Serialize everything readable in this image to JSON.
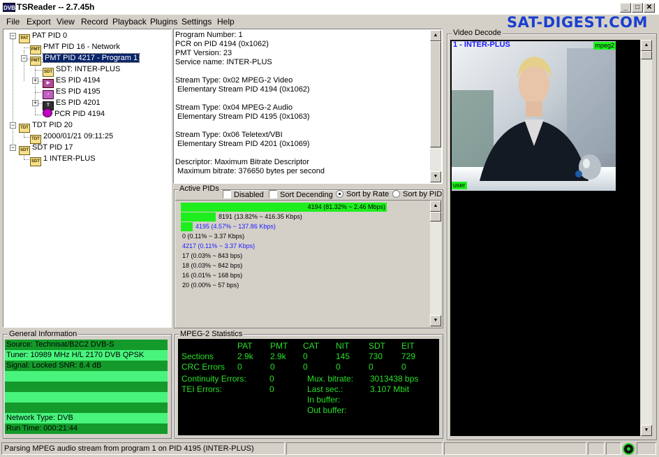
{
  "window": {
    "title": "TSReader -- 2.7.45h",
    "logo_text": "DVB",
    "watermark": "SAT-DIGEST.COM",
    "controls": {
      "minimize": "_",
      "maximize": "□",
      "close": "✕"
    }
  },
  "menu": [
    "File",
    "Export",
    "View",
    "Record",
    "Playback",
    "Plugins",
    "Settings",
    "Help"
  ],
  "tree": {
    "items": [
      {
        "label": "PAT PID 0",
        "icon": "pat-icon"
      },
      {
        "label": "PMT PID 16 - Network",
        "icon": "pmt-icon"
      },
      {
        "label": "PMT PID 4217 - Program 1",
        "icon": "pmt-icon",
        "selected": true
      },
      {
        "label": "SDT: INTER-PLUS",
        "icon": "sdt-icon"
      },
      {
        "label": "ES PID 4194",
        "icon": "video-stream-icon"
      },
      {
        "label": "ES PID 4195",
        "icon": "audio-stream-icon"
      },
      {
        "label": "ES PID 4201",
        "icon": "teletext-stream-icon"
      },
      {
        "label": "PCR PID 4194",
        "icon": "pcr-icon"
      },
      {
        "label": "TDT PID 20",
        "icon": "tdt-icon"
      },
      {
        "label": "2000/01/21 09:11:25",
        "icon": "tdt-icon"
      },
      {
        "label": "SDT PID 17",
        "icon": "sdt-icon"
      },
      {
        "label": "1 INTER-PLUS",
        "icon": "sdt-icon"
      }
    ]
  },
  "program_info": {
    "lines": [
      "Program Number: 1",
      "PCR on PID 4194 (0x1062)",
      "PMT Version: 23",
      "Service name: INTER-PLUS",
      "",
      "Stream Type: 0x02 MPEG-2 Video",
      " Elementary Stream PID 4194 (0x1062)",
      "",
      "Stream Type: 0x04 MPEG-2 Audio",
      " Elementary Stream PID 4195 (0x1063)",
      "",
      "Stream Type: 0x06 Teletext/VBI",
      " Elementary Stream PID 4201 (0x1069)",
      "",
      "Descriptor: Maximum Bitrate Descriptor",
      " Maximum bitrate: 376650 bytes per second"
    ]
  },
  "active_pids": {
    "label": "Active PIDs",
    "disabled_label": "Disabled",
    "sort_desc_label": "Sort Decending",
    "sort_rate_label": "Sort by Rate",
    "sort_pid_label": "Sort by PID",
    "rows": [
      {
        "text": "4194 (81.32% ~ 2.46 Mbps)",
        "pct": 81.32,
        "color": "#000000"
      },
      {
        "text": "8191 (13.82% ~ 416.35 Kbps)",
        "pct": 13.82,
        "color": "#000000"
      },
      {
        "text": "4195 (4.57% ~ 137.86 Kbps)",
        "pct": 4.57,
        "color": "#1a1aff"
      },
      {
        "text": "0 (0.11% ~ 3.37 Kbps)",
        "pct": 0.11,
        "color": "#000000"
      },
      {
        "text": "4217 (0.11% ~ 3.37 Kbps)",
        "pct": 0.11,
        "color": "#1a1aff"
      },
      {
        "text": "17 (0.03% ~ 843 bps)",
        "pct": 0.03,
        "color": "#000000"
      },
      {
        "text": "18 (0.03% ~ 842 bps)",
        "pct": 0.03,
        "color": "#000000"
      },
      {
        "text": "16 (0.01% ~ 168 bps)",
        "pct": 0.01,
        "color": "#000000"
      },
      {
        "text": "20 (0.00% ~ 57 bps)",
        "pct": 0.0,
        "color": "#000000"
      }
    ]
  },
  "general_info": {
    "label": "General Information",
    "rows": [
      "Source: Technisat/B2C2 DVB-S",
      "Tuner: 10989 MHz H/L 2170 DVB QPSK",
      "Signal: Locked SNR: 8.4 dB",
      "",
      "",
      "",
      "",
      "Network Type: DVB",
      "Run Time: 000:21:44"
    ]
  },
  "mpeg_stats": {
    "label": "MPEG-2 Statistics",
    "headers": [
      "PAT",
      "PMT",
      "CAT",
      "NIT",
      "SDT",
      "EIT"
    ],
    "sections_label": "Sections",
    "sections": [
      "2.9k",
      "2.9k",
      "0",
      "145",
      "730",
      "729"
    ],
    "crc_label": "CRC Errors",
    "crc": [
      "0",
      "0",
      "0",
      "0",
      "0",
      "0"
    ],
    "continuity_label": "Continuity Errors:",
    "continuity_value": "0",
    "tei_label": "TEI Errors:",
    "tei_value": "0",
    "mux_label": "Mux. bitrate:",
    "mux_value": "3013438 bps",
    "last_label": "Last sec.:",
    "last_value": "3.107 Mbit",
    "inbuf_label": "In buffer:",
    "outbuf_label": "Out buffer:"
  },
  "video": {
    "label": "Video Decode",
    "channel": "1 - INTER-PLUS",
    "codec": "mpeg2",
    "user_tag": "user"
  },
  "status": {
    "message": "Parsing MPEG audio stream from program 1 on PID 4195 (INTER-PLUS)"
  },
  "colors": {
    "selection": "#0a246a",
    "bar_green": "#1eee1e",
    "stat_green": "#28e028",
    "watermark_blue": "#1a3fd0"
  }
}
